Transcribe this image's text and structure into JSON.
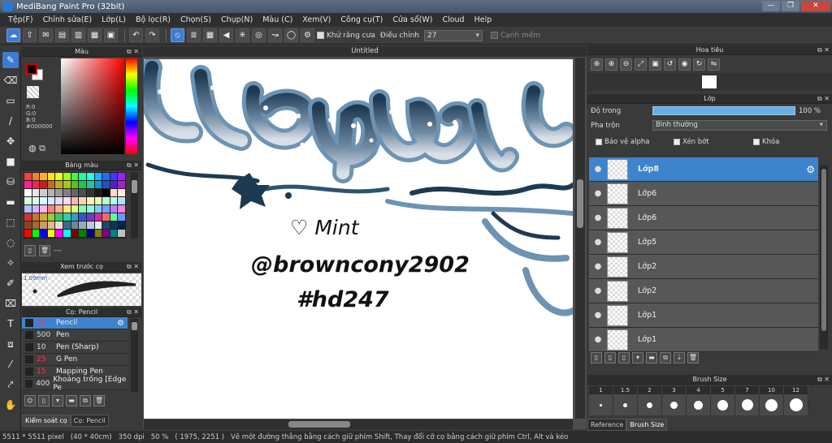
{
  "window": {
    "title": "MediBang Paint Pro (32bit)",
    "min": "—",
    "max": "❐",
    "close": "✕"
  },
  "menu": [
    "Tệp(F)",
    "Chỉnh sửa(E)",
    "Lớp(L)",
    "Bộ lọc(R)",
    "Chọn(S)",
    "Chụp(N)",
    "Màu (C)",
    "Xem(V)",
    "Công cụ(T)",
    "Cửa sổ(W)",
    "Cloud",
    "Help"
  ],
  "toolbar": {
    "antialias_label": "Khử răng cưa",
    "correction_label": "Điều chỉnh",
    "correction_value": "27",
    "snap_label": "Cạnh mềm"
  },
  "color_panel": {
    "title": "Màu",
    "r": "R:0",
    "g": "G:0",
    "b": "B:0",
    "hex": "#000000"
  },
  "palette_panel": {
    "title": "Bảng màu",
    "footer_text": "---"
  },
  "palette_colors": [
    "#ff3b3b",
    "#ff7a2b",
    "#ffb21f",
    "#ffe11f",
    "#e9ff1f",
    "#9dff1f",
    "#3bff3b",
    "#1fff9d",
    "#1fffe9",
    "#1fb2ff",
    "#1f6bff",
    "#3b3bff",
    "#9d1fff",
    "#ff1f9d",
    "#ff1f4f",
    "#c71f1f",
    "#c76b1f",
    "#c7a71f",
    "#a7c71f",
    "#4fc71f",
    "#1fc74f",
    "#1fc7a7",
    "#1f8fc7",
    "#1f4fc7",
    "#4f1fc7",
    "#a71fc7",
    "#ffffff",
    "#e6e6e6",
    "#cccccc",
    "#b3b3b3",
    "#999999",
    "#808080",
    "#666666",
    "#4d4d4d",
    "#333333",
    "#1a1a1a",
    "#000000",
    "#ffd9d9",
    "#ffe9d9",
    "#d9ffd9",
    "#d9ffe9",
    "#d9f9ff",
    "#d9e9ff",
    "#e9d9ff",
    "#ffd9f4",
    "#ffb3b3",
    "#ffd1b3",
    "#fff0b3",
    "#e6ffb3",
    "#b3ffcc",
    "#b3fff0",
    "#b3e0ff",
    "#b3c2ff",
    "#d1b3ff",
    "#ffb3e6",
    "#ff8080",
    "#ffb380",
    "#ffe680",
    "#d4ff80",
    "#80ffaa",
    "#80ffe6",
    "#80ccff",
    "#8099ff",
    "#b380ff",
    "#ff80d4",
    "#cc3333",
    "#cc7033",
    "#ccaa33",
    "#99cc33",
    "#33cc66",
    "#33ccaa",
    "#3399cc",
    "#3355cc",
    "#7a33cc",
    "#cc3399",
    "#ff6666",
    "#66ff99",
    "#6699ff",
    "#884422",
    "#aa6633",
    "#cc9966",
    "#ddbb99",
    "#eeddcc",
    "#446688",
    "#668899",
    "#99aabb",
    "#bbccdd",
    "#ddeeff",
    "#224466",
    "#113355",
    "#002244",
    "#ff0000",
    "#00ff00",
    "#0000ff",
    "#ffff00",
    "#ff00ff",
    "#00ffff",
    "#800000",
    "#008000",
    "#000080",
    "#808000",
    "#800080",
    "#008080",
    "#c0c0c0"
  ],
  "preview_panel": {
    "title": "Xem trước cọ",
    "size": "1.09mm"
  },
  "brush_panel": {
    "title": "Cọ: Pencil",
    "brushes": [
      {
        "size": "15",
        "name": "Pencil",
        "selected": true,
        "red": true
      },
      {
        "size": "500",
        "name": "Pen"
      },
      {
        "size": "10",
        "name": "Pen (Sharp)"
      },
      {
        "size": "25",
        "name": "G Pen",
        "red": true
      },
      {
        "size": "15",
        "name": "Mapping Pen",
        "red": true
      },
      {
        "size": "400",
        "name": "Khoảng trống [Edge Pe"
      }
    ],
    "tab1": "Kiểm soát cọ",
    "tab2": "Cọ: Pencil"
  },
  "canvas": {
    "tab_title": "Untitled",
    "text_lines": [
      "♡ Mint",
      "@browncony2902",
      "#hd247"
    ]
  },
  "status": {
    "size": "5511 * 5511 pixel",
    "cm": "(40 * 40cm)",
    "dpi": "350 dpi",
    "zoom": "50 %",
    "coords": "( 1975, 2251 )",
    "hint": "Vẽ một đường thẳng bằng cách giữ phím Shift, Thay đổi cỡ cọ bằng cách giữ phím Ctrl, Alt và kéo"
  },
  "navigator": {
    "title": "Hoa tiêu"
  },
  "layer_panel": {
    "title": "Lớp",
    "opacity_label": "Độ trong",
    "opacity_value": "100 %",
    "blend_label": "Pha trộn",
    "blend_value": "Bình thường",
    "protect_alpha": "Bảo vệ alpha",
    "clip": "Xén bớt",
    "lock": "Khóa",
    "layers": [
      {
        "name": "Lớp8",
        "selected": true
      },
      {
        "name": "Lớp6"
      },
      {
        "name": "Lớp6"
      },
      {
        "name": "Lớp5"
      },
      {
        "name": "Lớp2"
      },
      {
        "name": "Lớp2"
      },
      {
        "name": "Lớp1"
      },
      {
        "name": "Lớp1"
      }
    ]
  },
  "brush_size_panel": {
    "title": "Brush Size",
    "sizes": [
      "1",
      "1.5",
      "2",
      "3",
      "4",
      "5",
      "7",
      "10",
      "12"
    ],
    "tab1": "Reference",
    "tab2": "Brush Size"
  }
}
